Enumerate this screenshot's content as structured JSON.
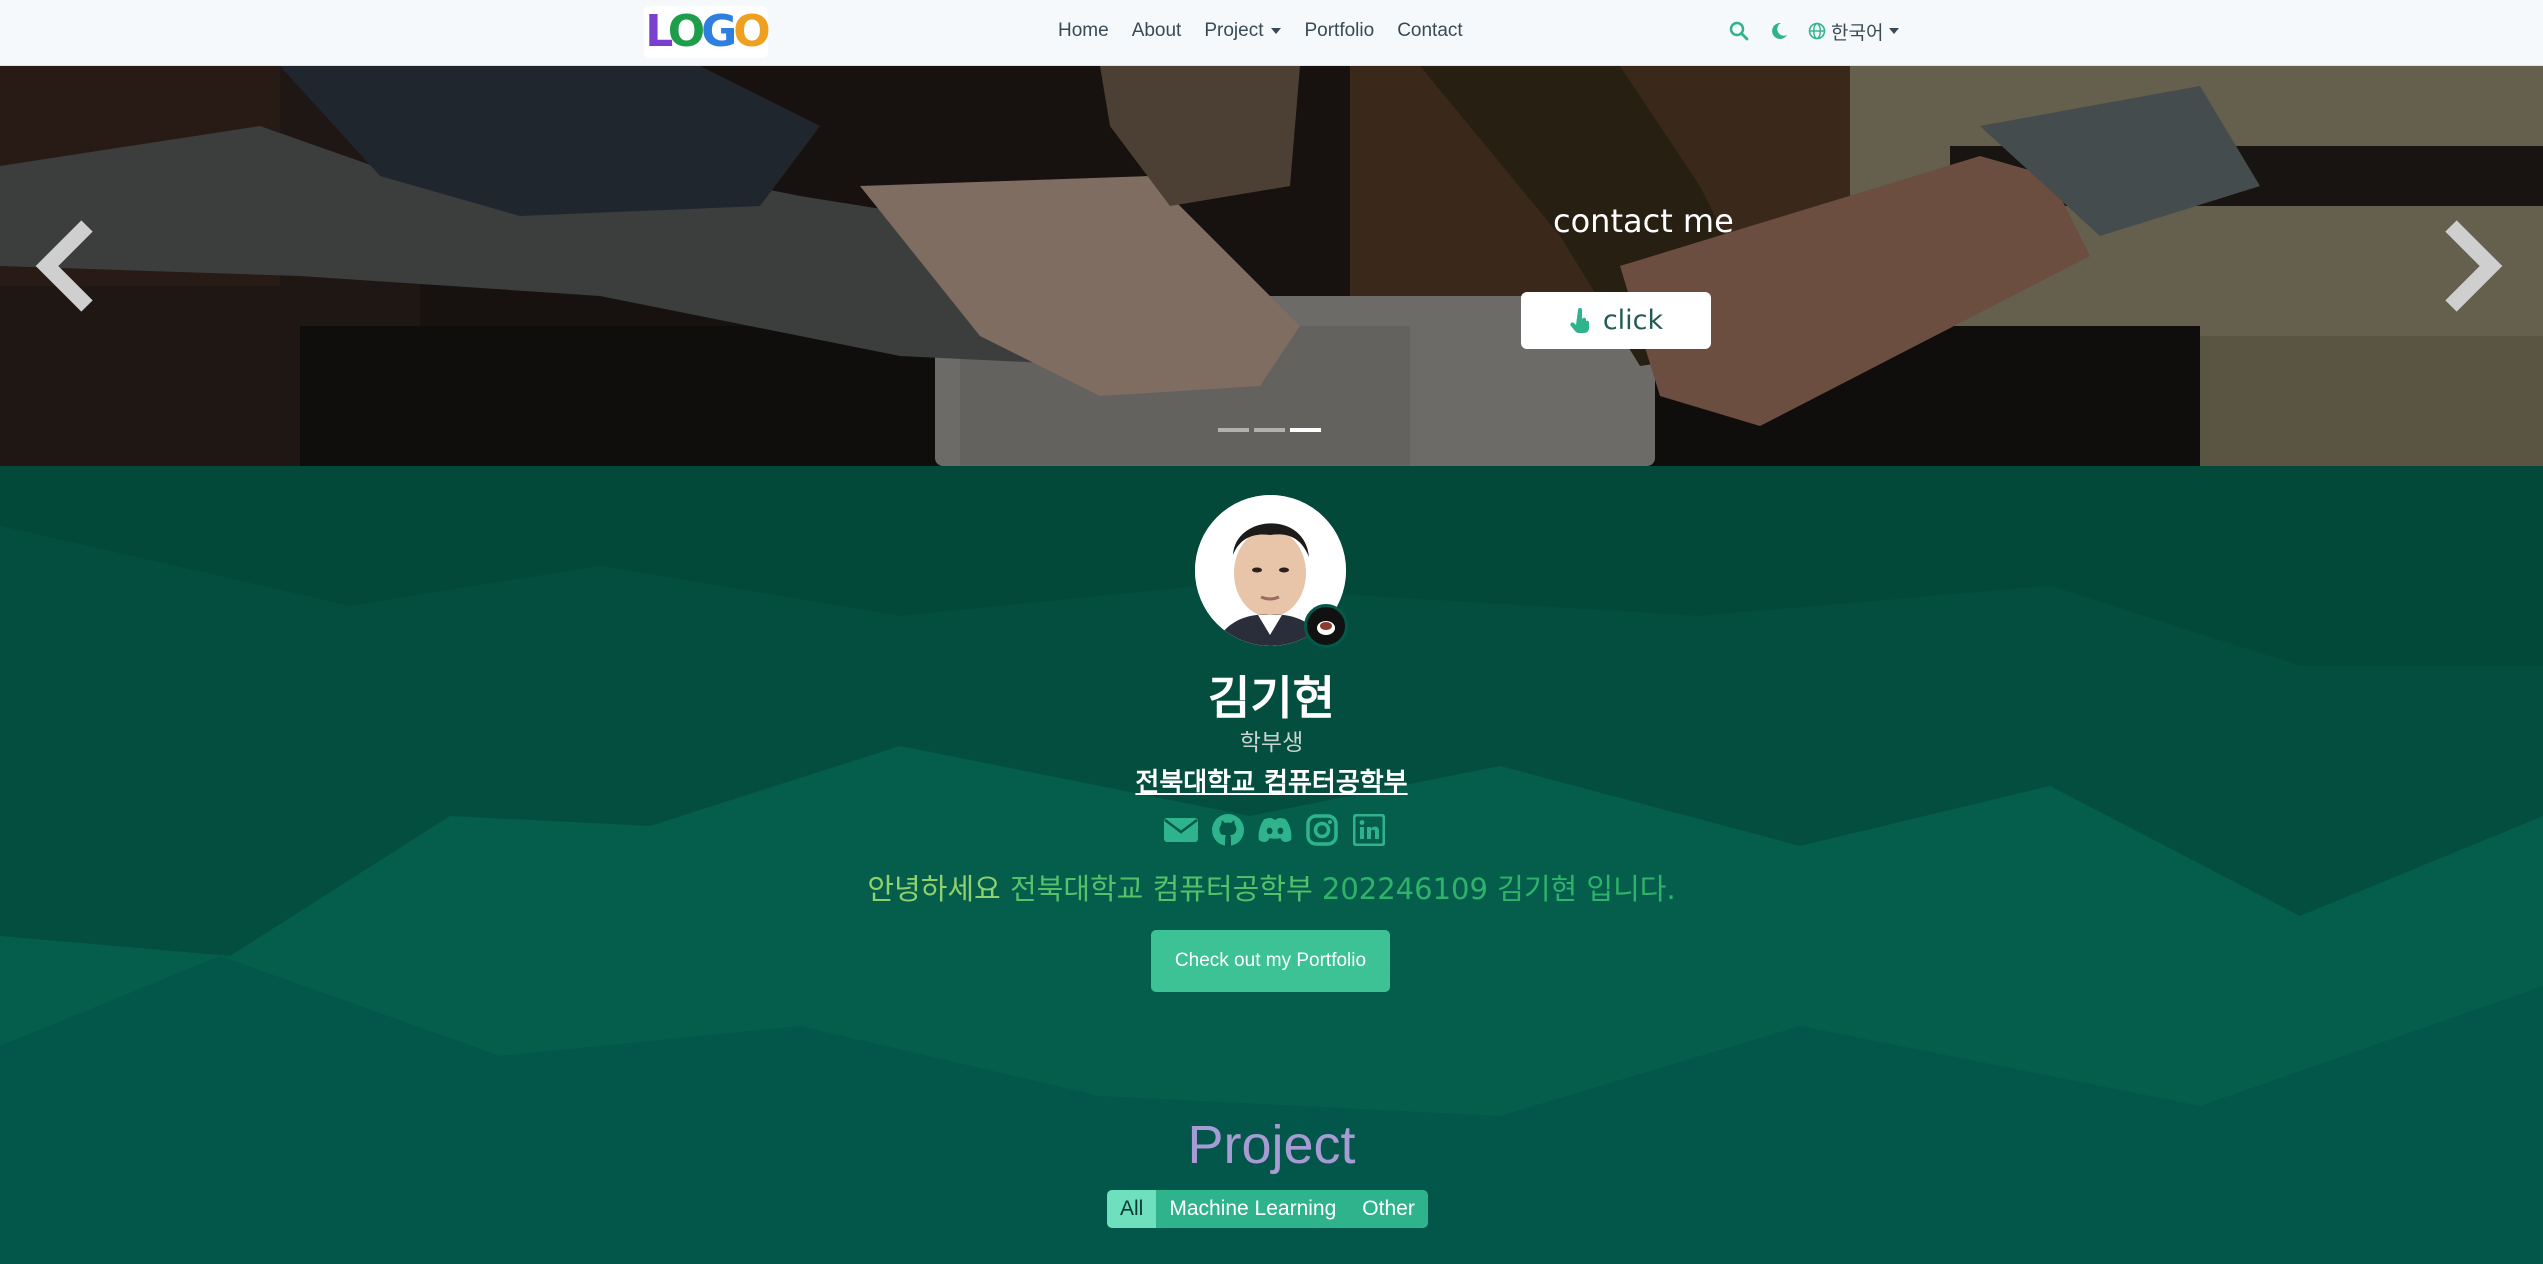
{
  "navbar": {
    "logo_text": "LOGO",
    "links": [
      "Home",
      "About",
      "Project",
      "Portfolio",
      "Contact"
    ],
    "search_icon": "search-icon",
    "theme_icon": "moon-icon",
    "language_label": "한국어"
  },
  "carousel": {
    "caption_title": "contact me",
    "button_label": "click",
    "slide_count": 3,
    "active_slide": 3
  },
  "profile": {
    "name": "김기현",
    "role": "학부생",
    "school": "전북대학교 컴퓨터공학부",
    "socials": [
      "envelope-icon",
      "github-icon",
      "discord-icon",
      "instagram-icon",
      "linkedin-icon"
    ],
    "intro_part1": "안녕하세요",
    "intro_part2": "전북대학교 컴퓨터공학부",
    "intro_part3": "202246109 김기현 입니다.",
    "cta_label": "Check out my Portfolio"
  },
  "project": {
    "title": "Project",
    "filters": [
      "All",
      "Machine Learning",
      "Other"
    ],
    "active_filter": "All"
  },
  "colors": {
    "nav_bg": "#f6f9fc",
    "section_bg": "#045a48",
    "accent": "#3cc295",
    "project_title": "#a79bd4"
  }
}
